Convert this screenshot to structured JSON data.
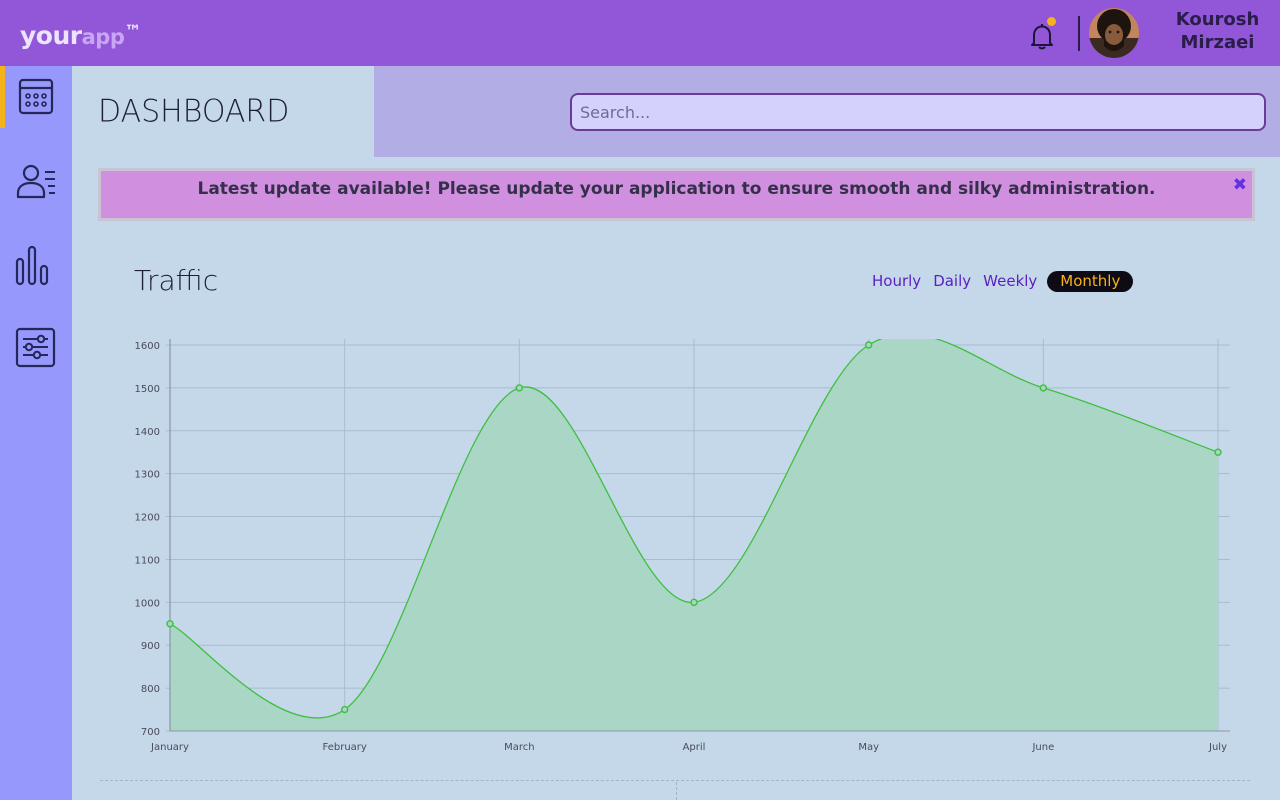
{
  "header": {
    "logo_primary": "your",
    "logo_secondary": "app",
    "logo_mark": "™",
    "user_name_first": "Kourosh",
    "user_name_last": "Mirzaei",
    "notification_icon": "bell-icon",
    "notification_color": "#f6b21a"
  },
  "sidebar": {
    "items": [
      {
        "icon": "calendar-icon",
        "active": true
      },
      {
        "icon": "users-list-icon",
        "active": false
      },
      {
        "icon": "bar-chart-icon",
        "active": false
      },
      {
        "icon": "settings-sliders-icon",
        "active": false
      }
    ],
    "accent_color": "#f6b21a"
  },
  "page": {
    "title": "DASHBOARD"
  },
  "search": {
    "placeholder": "Search..."
  },
  "alert": {
    "message": "Latest update available! Please update your application to ensure smooth and silky administration.",
    "close_glyph": "✖"
  },
  "traffic": {
    "title": "Traffic",
    "tabs": [
      {
        "label": "Hourly",
        "active": false
      },
      {
        "label": "Daily",
        "active": false
      },
      {
        "label": "Weekly",
        "active": false
      },
      {
        "label": "Monthly",
        "active": true
      }
    ]
  },
  "chart_data": {
    "type": "area",
    "title": "",
    "xlabel": "",
    "ylabel": "",
    "categories": [
      "January",
      "February",
      "March",
      "April",
      "May",
      "June",
      "July"
    ],
    "series": [
      {
        "values": [
          950,
          750,
          1500,
          1000,
          1600,
          1500,
          1350
        ],
        "color": "#3fbf3f",
        "fill": "#a9d6c4"
      }
    ],
    "ylim": [
      700,
      1600
    ],
    "yticks": [
      700,
      800,
      900,
      1000,
      1100,
      1200,
      1300,
      1400,
      1500,
      1600
    ],
    "grid": true,
    "legend": "none"
  }
}
